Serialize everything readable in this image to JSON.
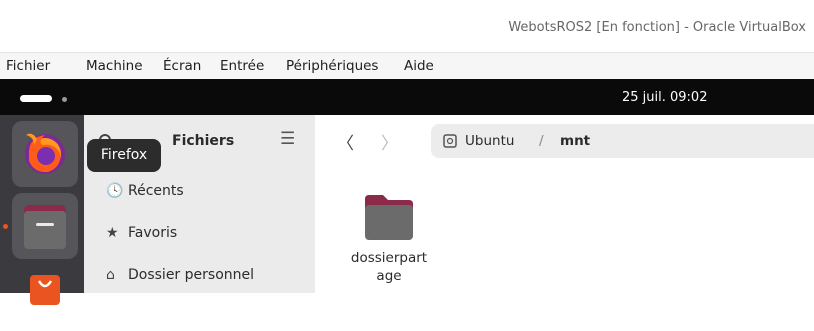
{
  "window": {
    "title": "WebotsROS2 [En fonction] - Oracle VirtualBox"
  },
  "menubar": {
    "items": [
      "Fichier",
      "Machine",
      "Écran",
      "Entrée",
      "Périphériques",
      "Aide"
    ]
  },
  "topbar": {
    "clock": "25 juil.  09:02"
  },
  "dock": {
    "apps": [
      {
        "name": "Firefox",
        "icon": "firefox-icon",
        "running": false
      },
      {
        "name": "Fichiers",
        "icon": "files-icon",
        "running": true
      },
      {
        "name": "Ubuntu Software",
        "icon": "software-icon",
        "running": false
      }
    ],
    "tooltip": "Firefox"
  },
  "files": {
    "sidebar_title": "Fichiers",
    "sidebar_items": [
      {
        "label": "Récents",
        "icon": "clock-icon"
      },
      {
        "label": "Favoris",
        "icon": "star-icon"
      },
      {
        "label": "Dossier personnel",
        "icon": "home-icon"
      }
    ],
    "path": {
      "root": "Ubuntu",
      "separator": "/",
      "current": "mnt"
    },
    "items": [
      {
        "name": "dossierpartage",
        "line1": "dossierpart",
        "line2": "age",
        "icon": "folder-icon"
      }
    ]
  },
  "colors": {
    "ubuntu_orange": "#e95420",
    "dock_bg": "#3b3b3f",
    "topbar_bg": "#0a0a0a"
  }
}
